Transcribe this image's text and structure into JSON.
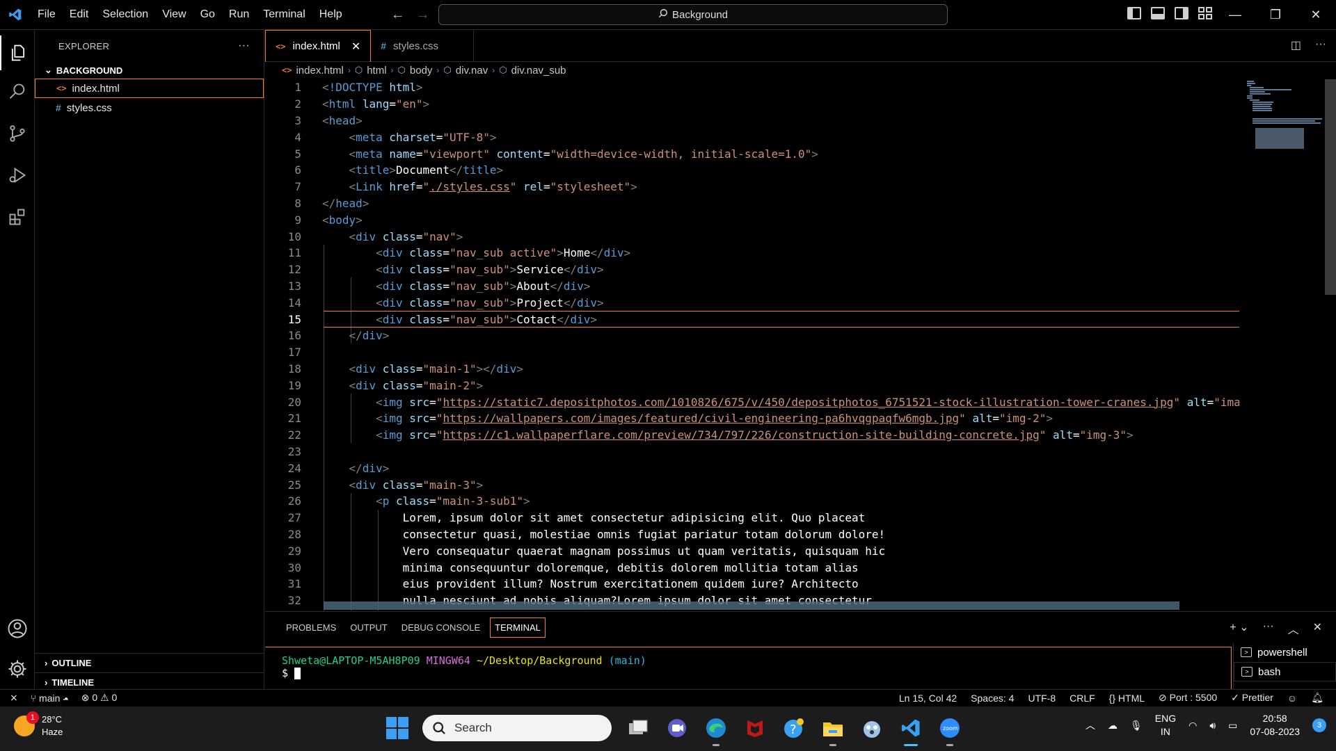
{
  "titlebar": {
    "menu": [
      "File",
      "Edit",
      "Selection",
      "View",
      "Go",
      "Run",
      "Terminal",
      "Help"
    ],
    "search_text": "Background"
  },
  "sidebar": {
    "title": "EXPLORER",
    "more": "···",
    "folder": "BACKGROUND",
    "files": [
      {
        "name": "index.html",
        "type": "html"
      },
      {
        "name": "styles.css",
        "type": "css"
      }
    ],
    "outline": "OUTLINE",
    "timeline": "TIMELINE"
  },
  "tabs": [
    {
      "label": "index.html",
      "icon": "<>",
      "close": "✕"
    },
    {
      "label": "styles.css",
      "icon": "#"
    }
  ],
  "breadcrumb": [
    "index.html",
    "html",
    "body",
    "div.nav",
    "div.nav_sub"
  ],
  "editor": {
    "current_line": 15,
    "lines": [
      {
        "n": "1",
        "code": "<!DOCTYPE html>"
      },
      {
        "n": "2",
        "code": "<html lang=\"en\">"
      },
      {
        "n": "3",
        "code": "<head>"
      },
      {
        "n": "4",
        "code": "    <meta charset=\"UTF-8\">"
      },
      {
        "n": "5",
        "code": "    <meta name=\"viewport\" content=\"width=device-width, initial-scale=1.0\">"
      },
      {
        "n": "6",
        "code": "    <title>Document</title>"
      },
      {
        "n": "7",
        "code": "    <Link href=\"./styles.css\" rel=\"stylesheet\">"
      },
      {
        "n": "8",
        "code": "</head>"
      },
      {
        "n": "9",
        "code": "<body>"
      },
      {
        "n": "10",
        "code": "    <div class=\"nav\">"
      },
      {
        "n": "11",
        "code": "        <div class=\"nav_sub active\">Home</div>"
      },
      {
        "n": "12",
        "code": "        <div class=\"nav_sub\">Service</div>"
      },
      {
        "n": "13",
        "code": "        <div class=\"nav_sub\">About</div>"
      },
      {
        "n": "14",
        "code": "        <div class=\"nav_sub\">Project</div>"
      },
      {
        "n": "15",
        "code": "        <div class=\"nav_sub\">Cotact</div>"
      },
      {
        "n": "16",
        "code": "    </div>"
      },
      {
        "n": "17",
        "code": ""
      },
      {
        "n": "18",
        "code": "    <div class=\"main-1\"></div>"
      },
      {
        "n": "19",
        "code": "    <div class=\"main-2\">"
      },
      {
        "n": "20",
        "code": "        <img src=\"https://static7.depositphotos.com/1010826/675/v/450/depositphotos_6751521-stock-illustration-tower-cranes.jpg\" alt=\"ima"
      },
      {
        "n": "21",
        "code": "        <img src=\"https://wallpapers.com/images/featured/civil-engineering-pa6hvqgpaqfw6mgb.jpg\" alt=\"img-2\">"
      },
      {
        "n": "22",
        "code": "        <img src=\"https://c1.wallpaperflare.com/preview/734/797/226/construction-site-building-concrete.jpg\" alt=\"img-3\">"
      },
      {
        "n": "23",
        "code": ""
      },
      {
        "n": "24",
        "code": "    </div>"
      },
      {
        "n": "25",
        "code": "    <div class=\"main-3\">"
      },
      {
        "n": "26",
        "code": "        <p class=\"main-3-sub1\">"
      },
      {
        "n": "27",
        "code": "            Lorem, ipsum dolor sit amet consectetur adipisicing elit. Quo placeat"
      },
      {
        "n": "28",
        "code": "            consectetur quasi, molestiae omnis fugiat pariatur totam dolorum dolore!"
      },
      {
        "n": "29",
        "code": "            Vero consequatur quaerat magnam possimus ut quam veritatis, quisquam hic"
      },
      {
        "n": "30",
        "code": "            minima consequuntur doloremque, debitis dolorem mollitia totam alias"
      },
      {
        "n": "31",
        "code": "            eius provident illum? Nostrum exercitationem quidem iure? Architecto"
      },
      {
        "n": "32",
        "code": "            nulla nesciunt ad nobis aliquam?Lorem ipsum dolor sit amet consectetur"
      }
    ]
  },
  "panel": {
    "tabs": [
      "PROBLEMS",
      "OUTPUT",
      "DEBUG CONSOLE",
      "TERMINAL"
    ],
    "active_tab": "TERMINAL",
    "prompt_user": "Shweta@LAPTOP-M5AH8P09",
    "prompt_env": "MINGW64",
    "prompt_path": "~/Desktop/Background",
    "prompt_branch": "(main)",
    "prompt_symbol": "$",
    "terminals": [
      "powershell",
      "bash"
    ]
  },
  "statusbar": {
    "branch": "main",
    "errors": "0",
    "warnings": "0",
    "position": "Ln 15, Col 42",
    "spaces": "Spaces: 4",
    "encoding": "UTF-8",
    "eol": "CRLF",
    "language": "HTML",
    "port": "Port : 5500",
    "prettier": "Prettier"
  },
  "taskbar": {
    "weather_temp": "28°C",
    "weather_desc": "Haze",
    "weather_badge": "1",
    "search_label": "Search",
    "lang_1": "ENG",
    "lang_2": "IN",
    "time": "20:58",
    "date": "07-08-2023",
    "notifications": "3"
  },
  "colors": {
    "accent_border": "#f38518",
    "tag": "#569cd6",
    "attr": "#9cdcfe",
    "string": "#ce9178"
  }
}
